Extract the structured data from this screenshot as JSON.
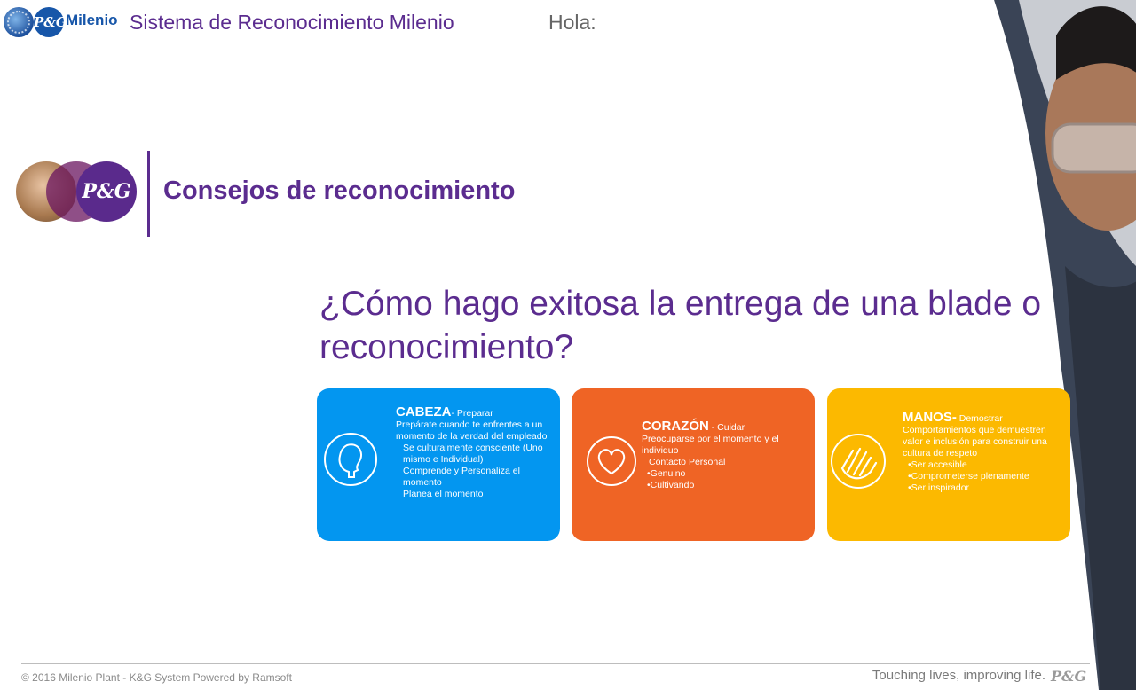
{
  "header": {
    "badge_text": "P&G",
    "brand": "Milenio",
    "app_title": "Sistema de Reconocimiento Milenio",
    "greeting": "Hola:"
  },
  "section": {
    "logo_text": "P&G",
    "title": "Consejos de reconocimiento"
  },
  "question": "¿Cómo hago exitosa la entrega de una blade o reconocimiento?",
  "cards": [
    {
      "color": "#0396f0",
      "icon": "head-icon",
      "heading": "CABEZA",
      "subheading": "- Preparar",
      "intro": "Prepárate cuando te enfrentes a un momento de la verdad del empleado",
      "bullets": [
        "Se culturalmente consciente (Uno mismo e Individual)",
        "Comprende y Personaliza el momento",
        "Planea el momento"
      ]
    },
    {
      "color": "#ef6425",
      "icon": "heart-icon",
      "heading": "CORAZÓN",
      "subheading": " - Cuidar",
      "intro": "Preocuparse por el momento y el individuo",
      "bullets": [
        "Contacto Personal",
        "•Genuino",
        "•Cultivando"
      ]
    },
    {
      "color": "#fcb900",
      "icon": "hand-icon",
      "heading": "MANOS-",
      "subheading": " Demostrar",
      "intro": "Comportamientos que demuestren valor e inclusión para construir una cultura de respeto",
      "bullets": [
        "•Ser accesible",
        "•Comprometerse plenamente",
        "•Ser inspirador"
      ]
    }
  ],
  "footer": {
    "copyright": "© 2016 Milenio Plant - K&G System Powered by Ramsoft",
    "tagline": "Touching lives, improving life.",
    "logo": "P&G"
  }
}
